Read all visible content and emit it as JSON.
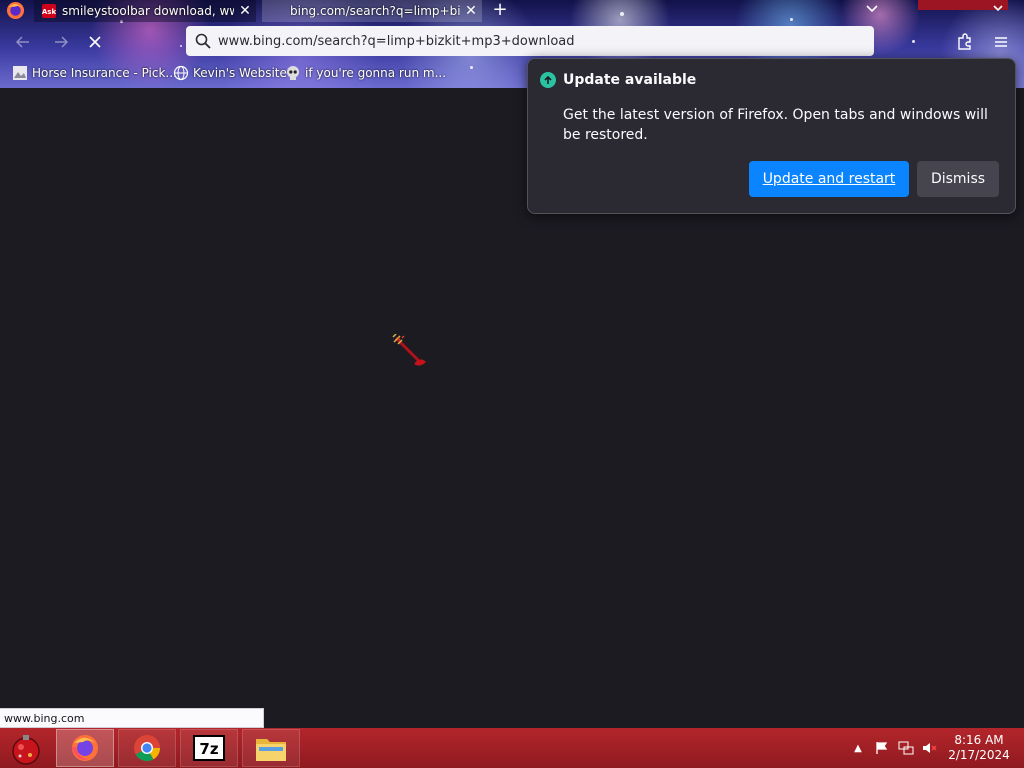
{
  "tabs": [
    {
      "title": "smileystoolbar download, ww...",
      "favicon": "ask-icon"
    },
    {
      "title": "bing.com/search?q=limp+bizki",
      "favicon": "none"
    }
  ],
  "navbar": {
    "url": "www.bing.com/search?q=limp+bizkit+mp3+download"
  },
  "bookmarks": [
    {
      "label": "Horse Insurance - Pick...",
      "icon": "page-icon"
    },
    {
      "label": "Kevin's Website",
      "icon": "globe-icon"
    },
    {
      "label": "if you're gonna run m...",
      "icon": "skull-icon"
    }
  ],
  "update_panel": {
    "title": "Update available",
    "message": "Get the latest version of Firefox. Open tabs and windows will be restored.",
    "primary_label": "Update and restart",
    "secondary_label": "Dismiss"
  },
  "status_url": "www.bing.com",
  "taskbar": {
    "apps": [
      "firefox",
      "chrome",
      "7-zip",
      "file-explorer"
    ],
    "seven_zip_label": "7z",
    "time": "8:16 AM",
    "date": "2/17/2024"
  },
  "colors": {
    "accent": "#0a84ff",
    "panel_bg": "#2b2a33",
    "page_bg": "#1c1b22",
    "taskbar": "#a52127",
    "update_icon": "#2ac3a2"
  }
}
